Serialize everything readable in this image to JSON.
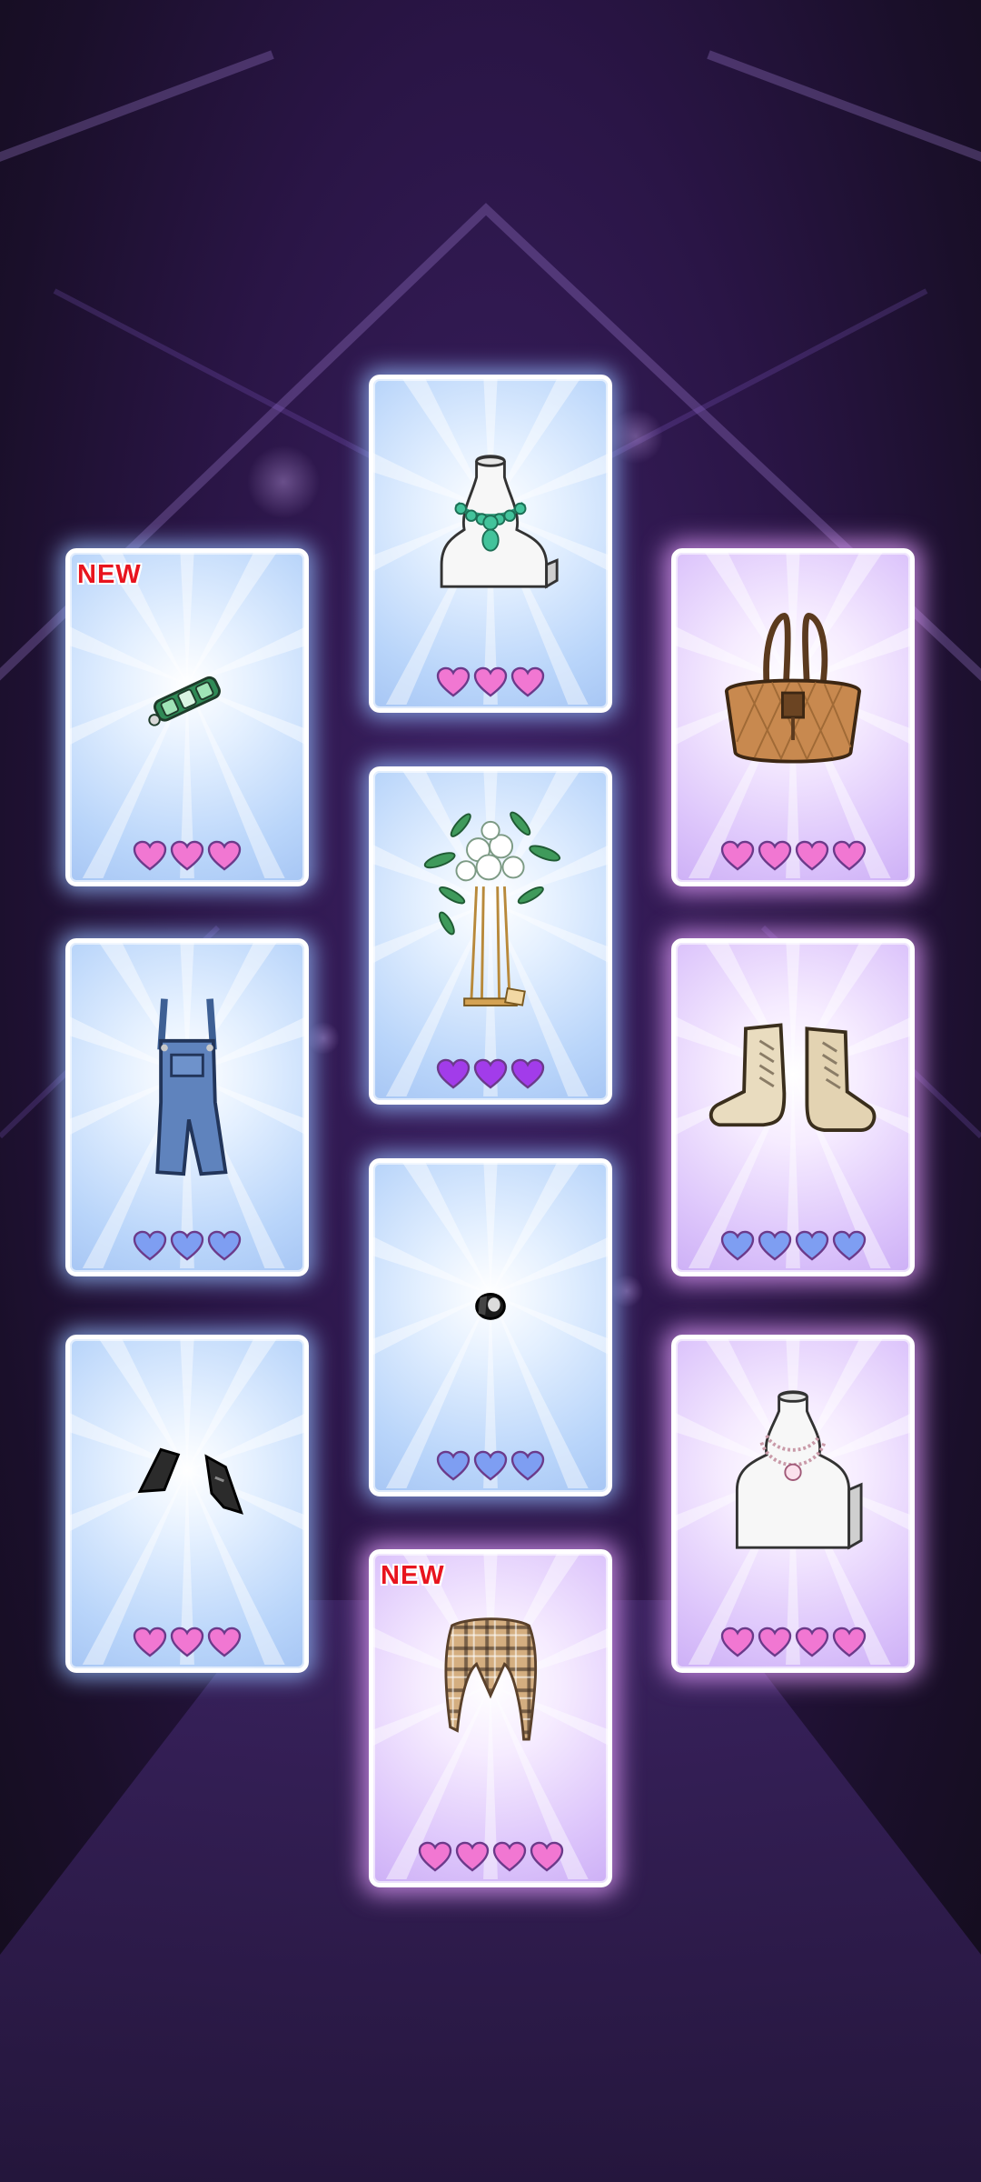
{
  "colors": {
    "heart_pink": "#f177d2",
    "heart_purple": "#a23cea",
    "heart_blue": "#7e9ef2",
    "new_badge": "#e8141e"
  },
  "cards": [
    {
      "name": "necklace-green",
      "icon": "green-gem-necklace-on-bust-icon",
      "theme": "blue",
      "hearts": 3,
      "heart_color": "pink",
      "badge": ""
    },
    {
      "name": "brooch-green",
      "icon": "green-gem-brooch-icon",
      "theme": "blue",
      "hearts": 3,
      "heart_color": "pink",
      "badge": "NEW"
    },
    {
      "name": "tote-bag",
      "icon": "woven-tote-bag-icon",
      "theme": "purple",
      "hearts": 4,
      "heart_color": "pink",
      "badge": ""
    },
    {
      "name": "flower-stand",
      "icon": "flower-bouquet-stand-icon",
      "theme": "blue",
      "hearts": 3,
      "heart_color": "purple",
      "badge": ""
    },
    {
      "name": "overalls",
      "icon": "denim-overalls-icon",
      "theme": "blue",
      "hearts": 3,
      "heart_color": "blue",
      "badge": ""
    },
    {
      "name": "boots",
      "icon": "lace-up-boots-icon",
      "theme": "purple",
      "hearts": 4,
      "heart_color": "blue",
      "badge": ""
    },
    {
      "name": "ring",
      "icon": "black-ring-icon",
      "theme": "blue",
      "hearts": 3,
      "heart_color": "blue",
      "badge": ""
    },
    {
      "name": "gloves",
      "icon": "black-gloves-icon",
      "theme": "blue",
      "hearts": 3,
      "heart_color": "pink",
      "badge": ""
    },
    {
      "name": "necklace-pearl",
      "icon": "layered-chain-necklace-on-bust-icon",
      "theme": "purple",
      "hearts": 4,
      "heart_color": "pink",
      "badge": ""
    },
    {
      "name": "plaid-scarf",
      "icon": "plaid-scarf-icon",
      "theme": "purple",
      "hearts": 4,
      "heart_color": "pink",
      "badge": "NEW"
    }
  ]
}
